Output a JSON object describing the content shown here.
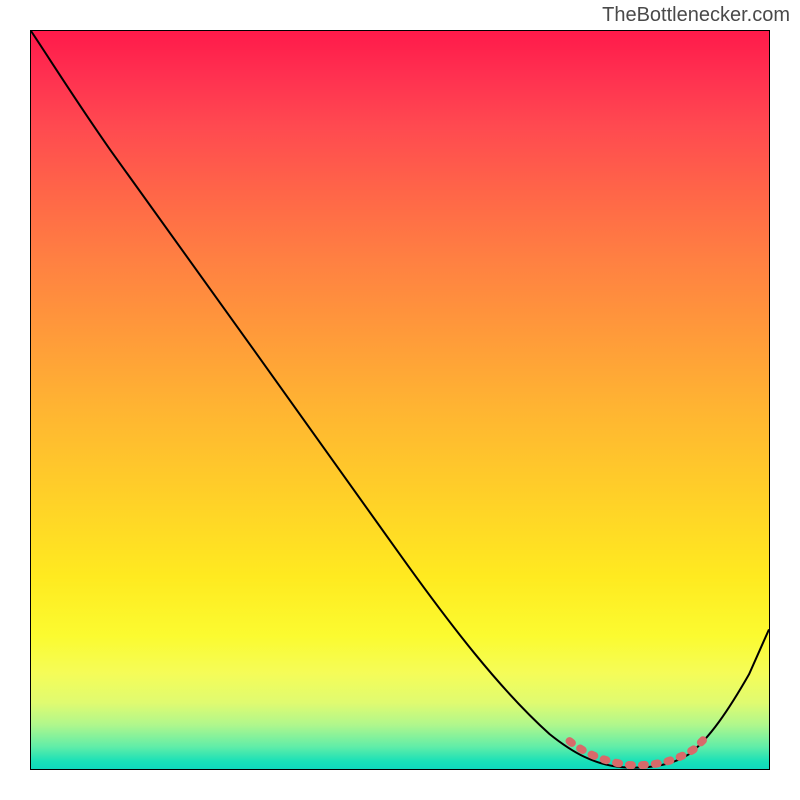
{
  "watermark": "TheBottlenecker.com",
  "chart_data": {
    "type": "line",
    "title": "",
    "xlabel": "",
    "ylabel": "",
    "xlim": [
      0,
      100
    ],
    "ylim": [
      0,
      100
    ],
    "series": [
      {
        "name": "bottleneck-curve",
        "color": "#000000",
        "x": [
          0,
          6,
          12,
          20,
          30,
          40,
          50,
          60,
          70,
          76,
          80,
          84,
          88,
          92,
          100
        ],
        "y": [
          100,
          94,
          86,
          76,
          63,
          50,
          37,
          24,
          11,
          4,
          1,
          0,
          1,
          4,
          18
        ]
      },
      {
        "name": "optimal-zone-highlight",
        "color": "#e06666",
        "stroke_width": 6,
        "x": [
          75,
          78,
          81,
          84,
          87,
          90,
          92
        ],
        "y": [
          4,
          2,
          1,
          0,
          1,
          2,
          4
        ]
      }
    ],
    "gradient_stops": [
      {
        "pos": 0,
        "color": "#ff1a4a"
      },
      {
        "pos": 50,
        "color": "#ffc028"
      },
      {
        "pos": 85,
        "color": "#fbfb40"
      },
      {
        "pos": 100,
        "color": "#0fd8bd"
      }
    ]
  }
}
